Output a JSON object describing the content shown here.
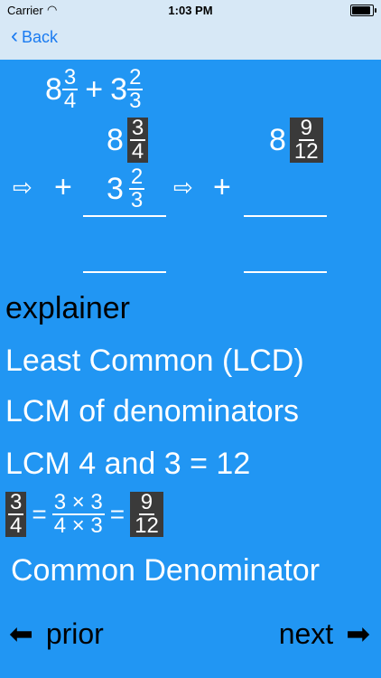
{
  "status": {
    "carrier": "Carrier",
    "time": "1:03 PM"
  },
  "nav": {
    "back_label": "Back"
  },
  "problem": {
    "whole1": "8",
    "num1": "3",
    "den1": "4",
    "op": "+",
    "whole2": "3",
    "num2": "2",
    "den2": "3"
  },
  "work": {
    "whole1": "8",
    "num1": "3",
    "den1": "4",
    "plus": "+",
    "whole2": "3",
    "num2": "2",
    "den2": "3",
    "arrow": "⇨",
    "right_whole": "8",
    "right_num": "9",
    "right_den": "12"
  },
  "explainer": {
    "heading": "explainer",
    "line1": "Least Common (LCD)",
    "line2": "LCM of denominators",
    "line3": "LCM 4 and 3 = 12",
    "eq": {
      "num": "3",
      "den": "4",
      "mult_num": "3 × 3",
      "mult_den": "4 × 3",
      "res_num": "9",
      "res_den": "12",
      "equals": "="
    },
    "line4": "Common Denominator"
  },
  "footer": {
    "prior_label": "prior",
    "next_label": "next"
  }
}
